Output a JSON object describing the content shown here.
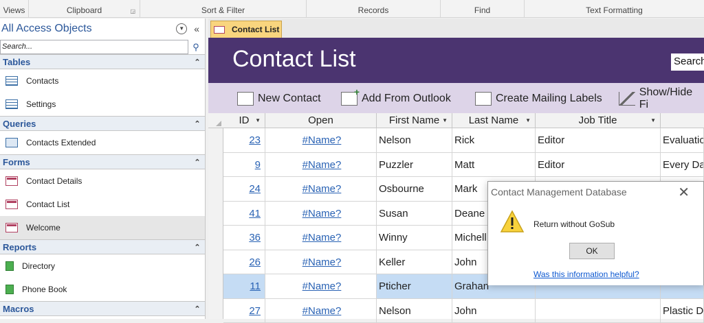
{
  "ribbon": {
    "groups": [
      "Views",
      "Clipboard",
      "Sort & Filter",
      "Records",
      "Find",
      "Text Formatting"
    ]
  },
  "nav": {
    "title": "All Access Objects",
    "search_placeholder": "Search...",
    "categories": [
      {
        "label": "Tables",
        "items": [
          "Contacts",
          "Settings"
        ]
      },
      {
        "label": "Queries",
        "items": [
          "Contacts Extended"
        ]
      },
      {
        "label": "Forms",
        "items": [
          "Contact Details",
          "Contact List",
          "Welcome"
        ]
      },
      {
        "label": "Reports",
        "items": [
          "Directory",
          "Phone Book"
        ]
      },
      {
        "label": "Macros",
        "items": []
      }
    ]
  },
  "document": {
    "tab_label": "Contact List",
    "header_title": "Contact List",
    "search_label": "Search"
  },
  "toolbar": {
    "new_contact": "New Contact",
    "add_from_outlook": "Add From Outlook",
    "create_mailing_labels": "Create Mailing Labels",
    "show_hide_fields": "Show/Hide Fi"
  },
  "grid": {
    "columns": [
      "ID",
      "Open",
      "First Name",
      "Last Name",
      "Job Title",
      ""
    ],
    "rows": [
      [
        "23",
        "#Name?",
        "Nelson",
        "Rick",
        "Editor",
        "Evaluatio"
      ],
      [
        "9",
        "#Name?",
        "Puzzler",
        "Matt",
        "Editor",
        "Every Da"
      ],
      [
        "24",
        "#Name?",
        "Osbourne",
        "Mark",
        "",
        ""
      ],
      [
        "41",
        "#Name?",
        "Susan",
        "Deane",
        "",
        ""
      ],
      [
        "36",
        "#Name?",
        "Winny",
        "Michell",
        "",
        ""
      ],
      [
        "26",
        "#Name?",
        "Keller",
        "John",
        "",
        ""
      ],
      [
        "11",
        "#Name?",
        "Pticher",
        "Grahan",
        "",
        ""
      ],
      [
        "27",
        "#Name?",
        "Nelson",
        "John",
        "",
        "Plastic D"
      ]
    ],
    "selected_row": 6
  },
  "dialog": {
    "title": "Contact Management Database",
    "message": "Return without GoSub",
    "ok_label": "OK",
    "help_link": "Was this information helpful?"
  }
}
